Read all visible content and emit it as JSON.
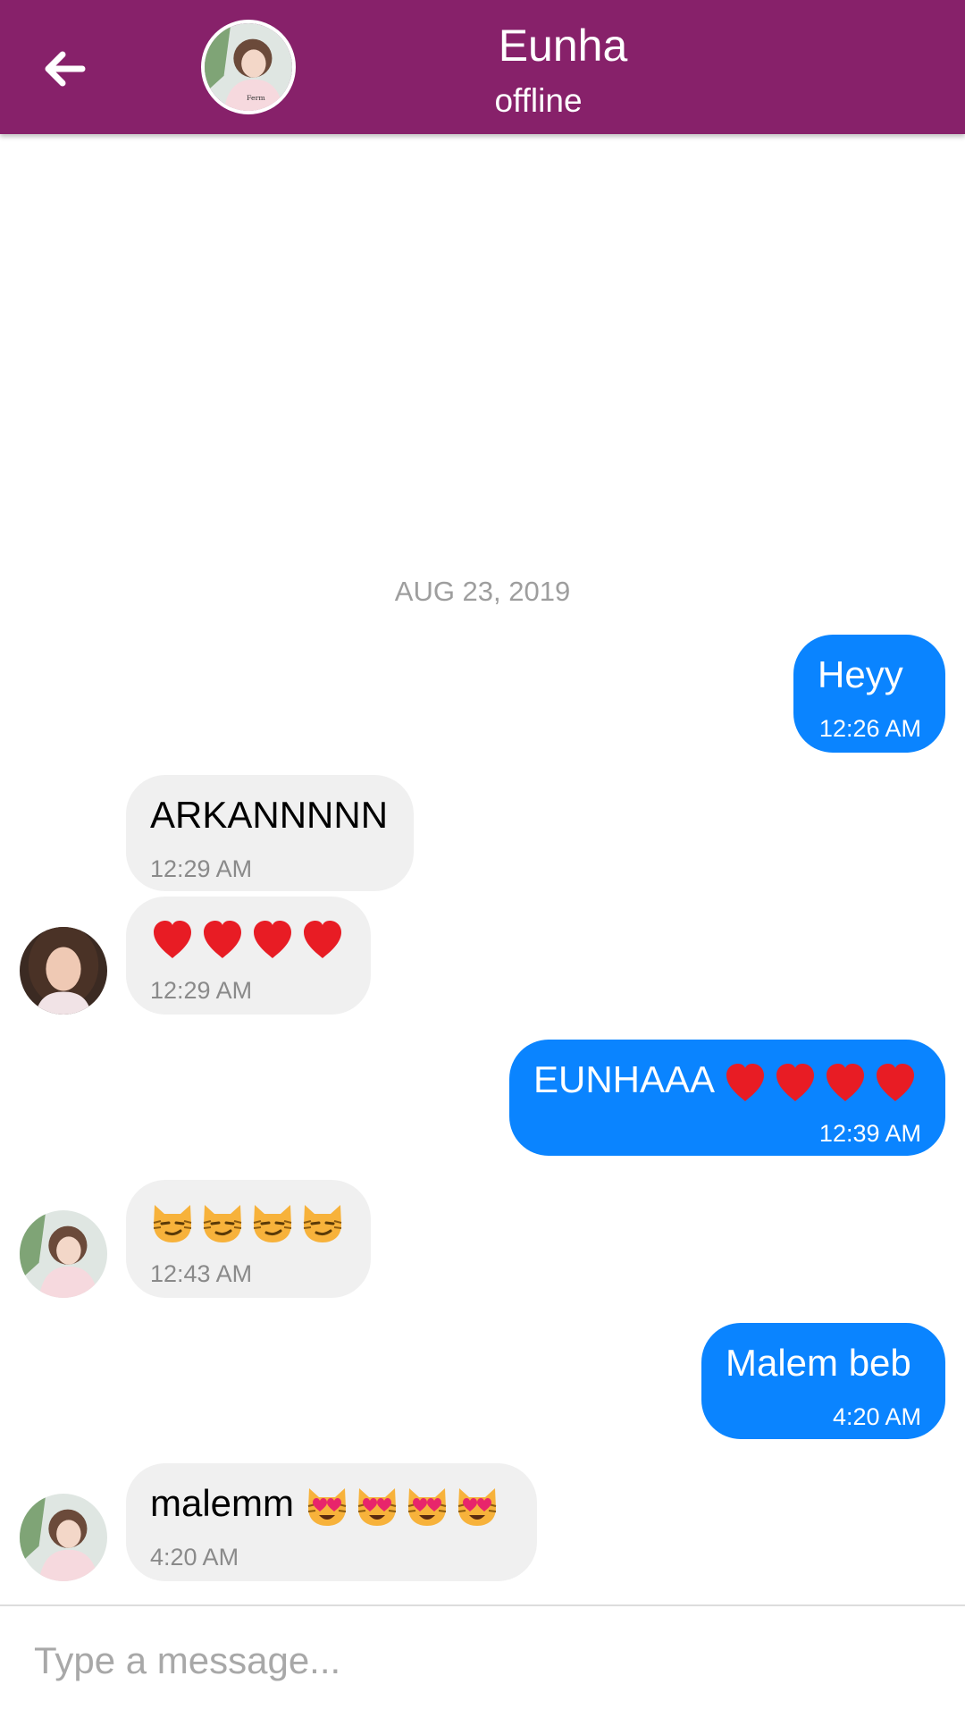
{
  "header": {
    "contact_name": "Eunha",
    "status": "offline"
  },
  "conversation": {
    "date_separator": "AUG 23, 2019",
    "messages": [
      {
        "direction": "outgoing",
        "text": "Heyy",
        "time": "12:26 AM"
      },
      {
        "direction": "incoming",
        "text": "ARKANNNNN",
        "time": "12:29 AM"
      },
      {
        "direction": "incoming",
        "text": "❤️❤️❤️❤️",
        "time": "12:29 AM"
      },
      {
        "direction": "outgoing",
        "text": "EUNHAAA ❤️❤️❤️❤️",
        "time": "12:39 AM"
      },
      {
        "direction": "incoming",
        "text": "😼😼😼😼",
        "time": "12:43 AM"
      },
      {
        "direction": "outgoing",
        "text": "Malem beb",
        "time": "4:20 AM"
      },
      {
        "direction": "incoming",
        "text": "malemm 😻😻😻😻",
        "time": "4:20 AM"
      }
    ],
    "emoji_icons": [
      "red-heart-icon",
      "smirking-cat-icon",
      "heart-eyes-cat-icon"
    ]
  },
  "composer": {
    "placeholder": "Type a message..."
  },
  "colors": {
    "header": "#87216a",
    "outgoing_bubble": "#0a84ff",
    "incoming_bubble": "#f0f0f0"
  }
}
